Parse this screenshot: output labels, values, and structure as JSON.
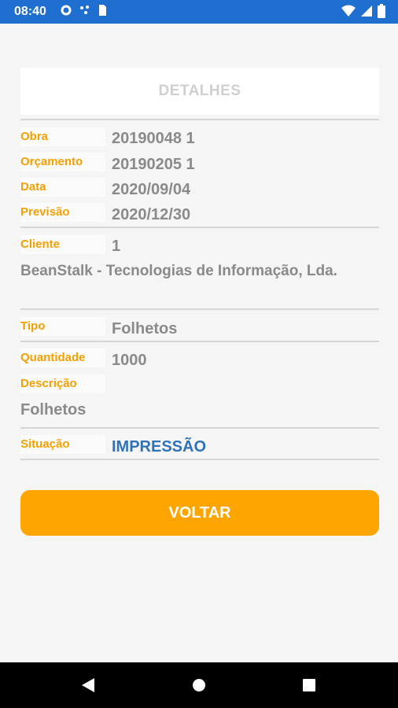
{
  "status_bar": {
    "time": "08:40",
    "icons": [
      "gear-icon",
      "dots-icon",
      "sim-icon",
      "wifi-icon",
      "signal-icon",
      "battery-icon"
    ]
  },
  "header": {
    "title": "DETALHES"
  },
  "fields": {
    "obra": {
      "label": "Obra",
      "value": "20190048   1"
    },
    "orcamento": {
      "label": "Orçamento",
      "value": "20190205   1"
    },
    "data": {
      "label": "Data",
      "value": "2020/09/04"
    },
    "previsao": {
      "label": "Previsão",
      "value": "2020/12/30"
    },
    "cliente": {
      "label": "Cliente",
      "value": "1",
      "name": "BeanStalk - Tecnologias de Informação, Lda."
    },
    "tipo": {
      "label": "Tipo",
      "value": "Folhetos"
    },
    "quantidade": {
      "label": "Quantidade",
      "value": "1000"
    },
    "descricao": {
      "label": "Descrição",
      "value": "Folhetos"
    },
    "situacao": {
      "label": "Situação",
      "value": "IMPRESSÃO"
    }
  },
  "actions": {
    "back_label": "VOLTAR"
  },
  "colors": {
    "accent": "#ffa500",
    "label": "#f5a000",
    "status": "#2f72b8",
    "statusbar": "#1f6fd1"
  },
  "nav_bar": {
    "icons": [
      "back-triangle-icon",
      "home-circle-icon",
      "recents-square-icon"
    ]
  }
}
